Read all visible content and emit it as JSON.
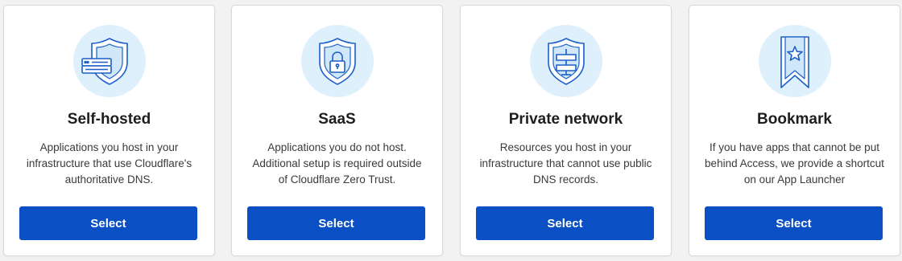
{
  "cards": [
    {
      "icon": "shield-server-icon",
      "title": "Self-hosted",
      "description": "Applications you host in your infrastructure that use Cloudflare's authoritative DNS.",
      "button_label": "Select"
    },
    {
      "icon": "shield-lock-icon",
      "title": "SaaS",
      "description": "Applications you do not host. Additional setup is required outside of Cloudflare Zero Trust.",
      "button_label": "Select"
    },
    {
      "icon": "shield-network-icon",
      "title": "Private network",
      "description": "Resources you host in your infrastructure that cannot use public DNS records.",
      "button_label": "Select"
    },
    {
      "icon": "bookmark-star-icon",
      "title": "Bookmark",
      "description": "If you have apps that cannot be put behind Access, we provide a shortcut on our App Launcher",
      "button_label": "Select"
    }
  ],
  "colors": {
    "accent": "#0a4fc4",
    "icon_stroke": "#1b5fc9",
    "icon_bg": "#def0fb"
  }
}
